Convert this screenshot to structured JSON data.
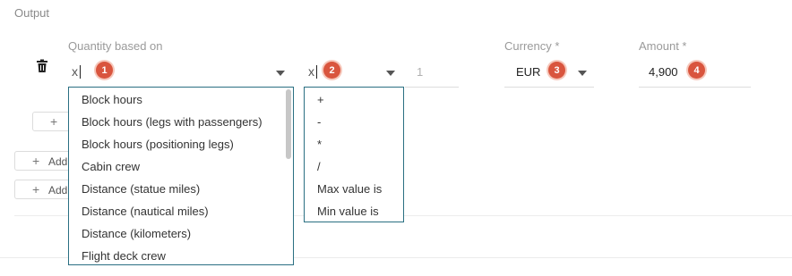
{
  "section": {
    "title": "Output"
  },
  "columns": {
    "quantity_label": "Quantity based on",
    "currency_label": "Currency *",
    "amount_label": "Amount *"
  },
  "row": {
    "quantity_value": "x",
    "operator_value": "x",
    "factor_placeholder": "1",
    "currency_value": "EUR",
    "amount_value": "4,900"
  },
  "badges": [
    "1",
    "2",
    "3",
    "4"
  ],
  "quantity_options": [
    "Block hours",
    "Block hours (legs with passengers)",
    "Block hours (positioning legs)",
    "Cabin crew",
    "Distance (statue miles)",
    "Distance (nautical miles)",
    "Distance (kilometers)",
    "Flight deck crew"
  ],
  "operator_options": [
    "+",
    "-",
    "*",
    "/",
    "Max value is",
    "Min value is"
  ],
  "buttons": {
    "plus": "+",
    "add_label_1": "Add",
    "add_label_2": "Add"
  },
  "colors": {
    "badge": "#d9553e",
    "dropdown_border": "#2a6f82"
  }
}
